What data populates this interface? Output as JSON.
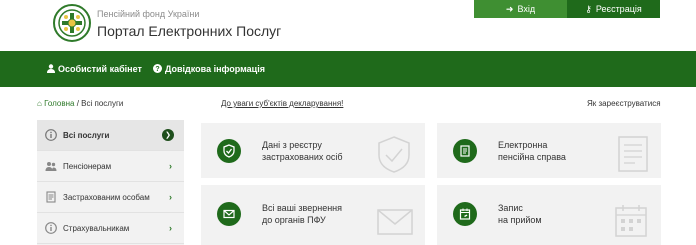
{
  "header": {
    "org_name": "Пенсійний фонд України",
    "portal_name": "Портал Електронних Послуг",
    "login_label": "Вхід",
    "register_label": "Реєстрація"
  },
  "nav": {
    "cabinet_label": "Особистий кабінет",
    "help_label": "Довідкова інформація"
  },
  "breadcrumb": {
    "home": "Головна",
    "separator": " / ",
    "current": "Всі послуги"
  },
  "notice": "До уваги суб'єктів декларування!",
  "how_register": "Як зареєструватися",
  "sidebar": {
    "items": [
      {
        "label": "Всі послуги",
        "icon": "info-circle-icon",
        "active": true
      },
      {
        "label": "Пенсіонерам",
        "icon": "users-icon",
        "active": false
      },
      {
        "label": "Застрахованим особам",
        "icon": "document-icon",
        "active": false
      },
      {
        "label": "Страхувальникам",
        "icon": "info-icon",
        "active": false
      }
    ]
  },
  "cards": [
    {
      "line1": "Дані з реєстру",
      "line2": "застрахованих осіб",
      "icon": "shield-icon"
    },
    {
      "line1": "Електронна",
      "line2": "пенсійна справа",
      "icon": "folder-icon"
    },
    {
      "line1": "Всі ваші звернення",
      "line2": "до органів ПФУ",
      "icon": "envelope-icon"
    },
    {
      "line1": "Запис",
      "line2": "на прийом",
      "icon": "calendar-icon"
    }
  ],
  "colors": {
    "brand_green": "#1f6a1b",
    "light_green": "#3f8f32",
    "card_bg": "#f2f2f2"
  }
}
